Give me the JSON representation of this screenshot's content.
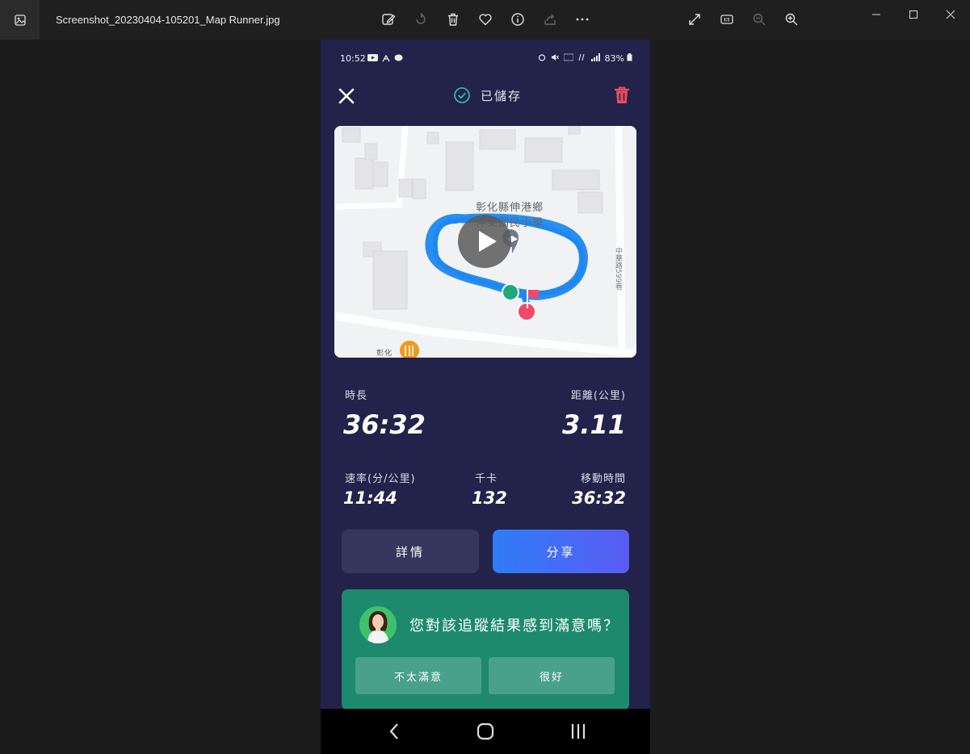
{
  "viewer": {
    "file_name": "Screenshot_20230404-105201_Map Runner.jpg"
  },
  "status_bar": {
    "time": "10:52",
    "battery": "83%"
  },
  "header": {
    "saved_label": "已儲存"
  },
  "map": {
    "place_label_line1": "彰化縣伸港鄉",
    "place_label_line2": "伸東國民小學",
    "road_label": "中華路599巷",
    "road_label_bottom": "彰化",
    "route_color": "#1e88f0",
    "start_marker_color": "#1fa97a",
    "end_marker_color": "#f04a6a"
  },
  "metrics": {
    "duration_label": "時長",
    "duration_value": "36:32",
    "distance_label": "距離(公里)",
    "distance_value": "3.11",
    "pace_label": "速率(分/公里)",
    "pace_value": "11:44",
    "calories_label": "千卡",
    "calories_value": "132",
    "moving_time_label": "移動時間",
    "moving_time_value": "36:32"
  },
  "actions": {
    "details_label": "詳情",
    "share_label": "分享"
  },
  "feedback": {
    "question": "您對該追蹤結果感到滿意嗎？",
    "not_satisfied_label": "不太滿意",
    "good_label": "很好"
  },
  "colors": {
    "background": "#22224a",
    "accent_blue": "#2f7cf6",
    "feedback_green": "#1d8a6e",
    "trash_red": "#ef4b61"
  }
}
